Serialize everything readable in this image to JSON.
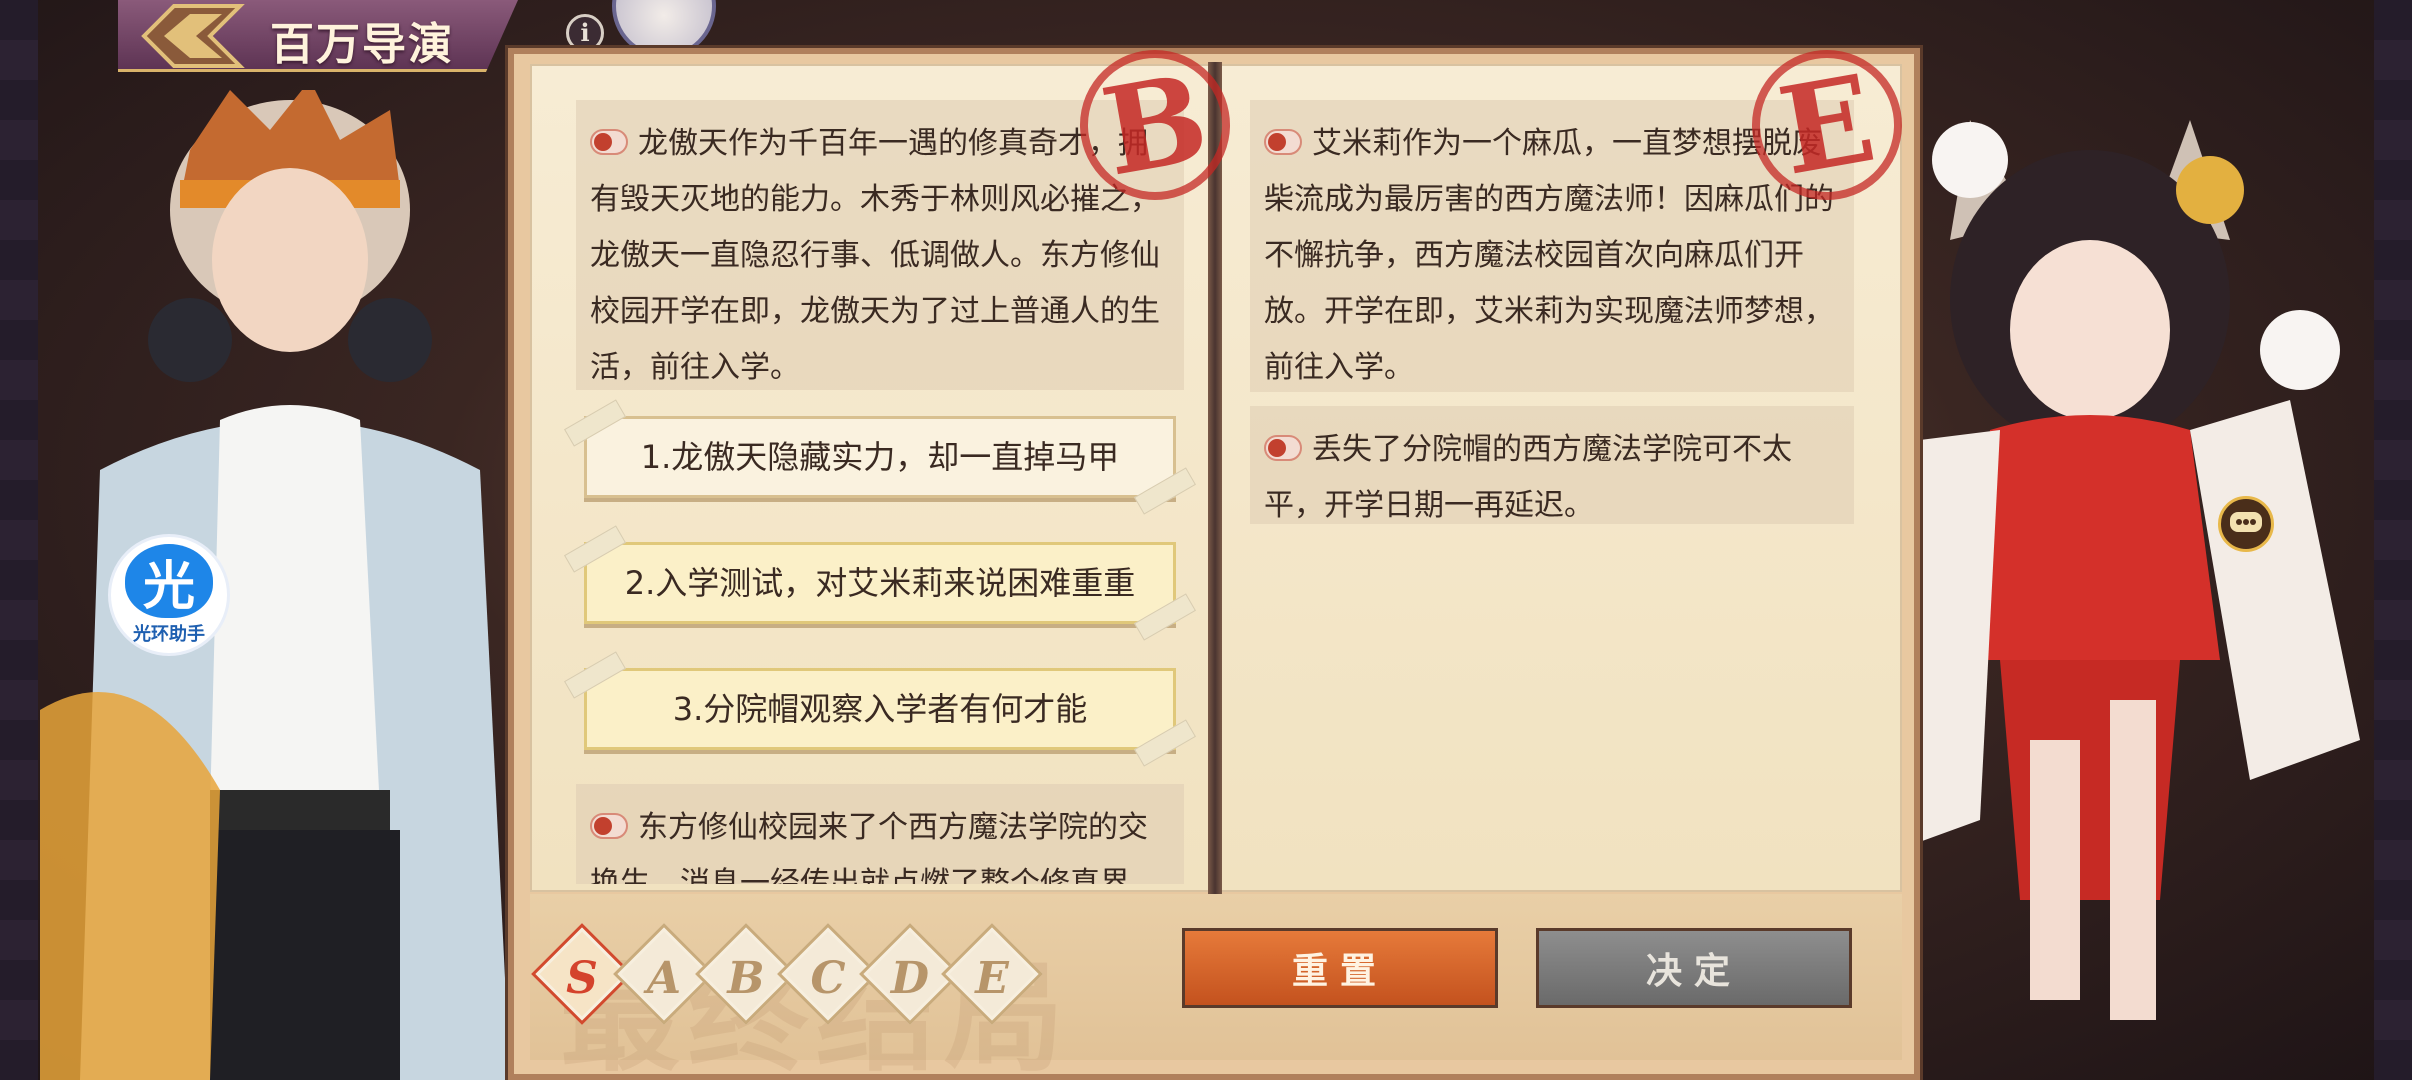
{
  "header": {
    "title": "百万导演",
    "info_label": "i"
  },
  "assistant": {
    "glyph": "光",
    "label": "光环助手"
  },
  "panel": {
    "left": {
      "stamp": "B",
      "story": "龙傲天作为千百年一遇的修真奇才，拥有毁天灭地的能力。木秀于林则风必摧之，龙傲天一直隐忍行事、低调做人。东方修仙校园开学在即，龙傲天为了过上普通人的生活，前往入学。",
      "options": [
        {
          "label": "1.龙傲天隐藏实力，却一直掉马甲"
        },
        {
          "label": "2.入学测试，对艾米莉来说困难重重"
        },
        {
          "label": "3.分院帽观察入学者有何才能"
        }
      ],
      "story2": "东方修仙校园来了个西方魔法学院的交换生，消息一经传出就点燃了整个修真界"
    },
    "right": {
      "stamp": "E",
      "story": "艾米莉作为一个麻瓜，一直梦想摆脱废柴流成为最厉害的西方魔法师！因麻瓜们的不懈抗争，西方魔法校园首次向麻瓜们开放。开学在即，艾米莉为实现魔法师梦想，前往入学。",
      "story2": "丢失了分院帽的西方魔法学院可不太平，开学日期一再延迟。"
    }
  },
  "grades": [
    "S",
    "A",
    "B",
    "C",
    "D",
    "E"
  ],
  "active_grade": "S",
  "watermark": "最终结局",
  "buttons": {
    "reset": "重置",
    "confirm": "决定"
  },
  "colors": {
    "accent": "#d4432c",
    "reset": "#e67a3a",
    "confirm": "#7a7a7a",
    "title_bg": "#5e3454"
  }
}
